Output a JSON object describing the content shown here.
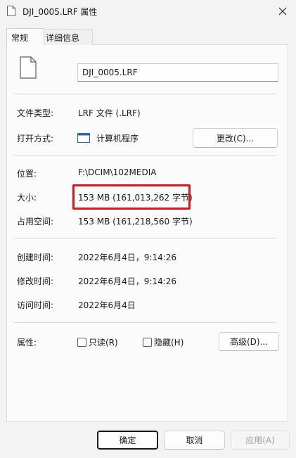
{
  "window": {
    "title": "DJI_0005.LRF 属性"
  },
  "tabs": [
    {
      "label": "常规"
    },
    {
      "label": "详细信息"
    }
  ],
  "file": {
    "name": "DJI_0005.LRF"
  },
  "general": {
    "type_label": "文件类型:",
    "type_value": "LRF 文件 (.LRF)",
    "opens_with_label": "打开方式:",
    "opens_with_value": "计算机程序",
    "change_button": "更改(C)...",
    "location_label": "位置:",
    "location_value": "F:\\DCIM\\102MEDIA",
    "size_label": "大小:",
    "size_value": "153 MB (161,013,262 字节)",
    "size_on_disk_label": "占用空间:",
    "size_on_disk_value": "153 MB (161,218,560 字节)",
    "created_label": "创建时间:",
    "created_value": "2022年6月4日，9:14:26",
    "modified_label": "修改时间:",
    "modified_value": "2022年6月4日，9:14:26",
    "accessed_label": "访问时间:",
    "accessed_value": "2022年6月4日",
    "attributes_label": "属性:",
    "readonly_label": "只读(R)",
    "hidden_label": "隐藏(H)",
    "advanced_button": "高级(D)...",
    "readonly_checked": false,
    "hidden_checked": false
  },
  "footer": {
    "ok": "确定",
    "cancel": "取消",
    "apply": "应用(A)"
  },
  "colors": {
    "highlight": "#e0141e"
  },
  "icons": {
    "file": "document-icon",
    "app": "application-window-icon",
    "close": "close-icon"
  }
}
